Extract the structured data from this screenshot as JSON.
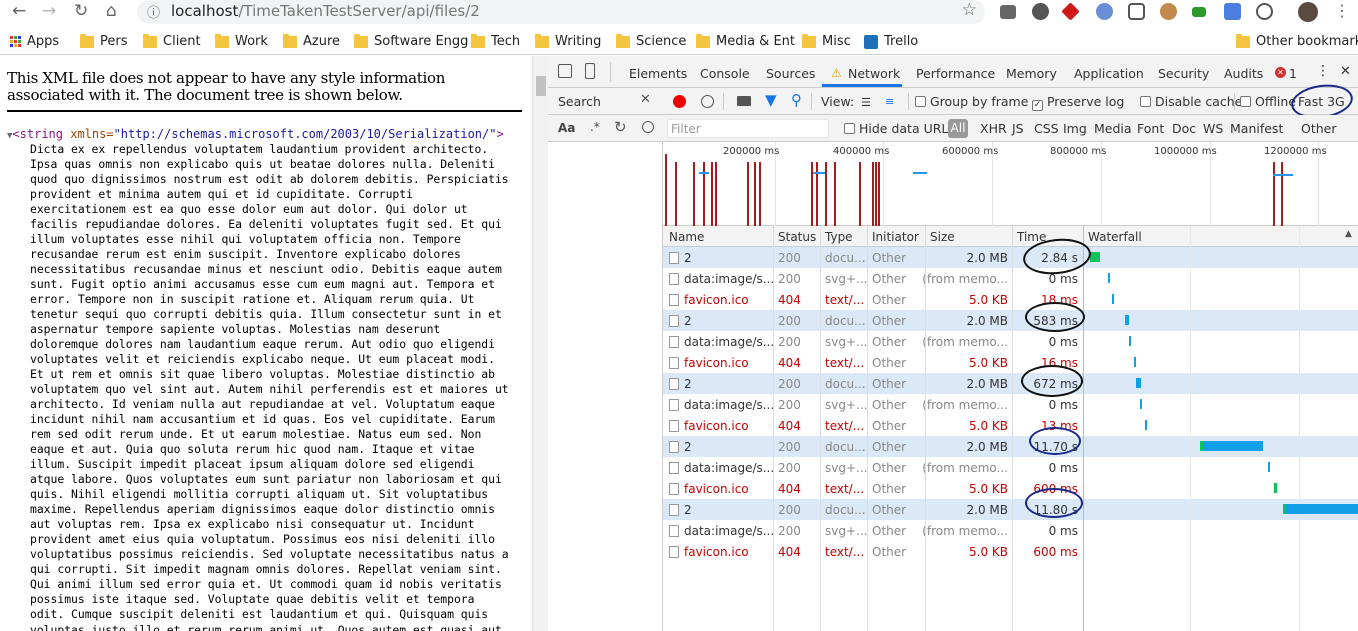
{
  "browser": {
    "url_host": "localhost",
    "url_path": "/TimeTakenTestServer/api/files/2",
    "bookmarks": [
      "Apps",
      "Pers",
      "Client",
      "Work",
      "Azure",
      "Software Engg",
      "Tech",
      "Writing",
      "Science",
      "Media & Ent",
      "Misc",
      "Trello"
    ],
    "other_bookmarks": "Other bookmarks"
  },
  "xml": {
    "header": "This XML file does not appear to have any style information associated with it. The document tree is shown below.",
    "tag_open": "<string",
    "attr_name": " xmlns=",
    "attr_value": "\"http://schemas.microsoft.com/2003/10/Serialization/\"",
    "tag_close": ">",
    "body_lines": [
      "Dicta ex ex repellendus voluptatem laudantium provident architecto.",
      "Ipsa quas omnis non explicabo quis ut beatae dolores nulla. Deleniti",
      "quod quo dignissimos nostrum est odit ab dolorem debitis. Perspiciatis",
      "provident et minima autem qui et id cupiditate. Corrupti",
      "exercitationem est ea quo esse dolor eum aut dolor. Qui dolor ut",
      "facilis repudiandae dolores. Ea deleniti voluptates fugit sed. Et qui",
      "illum voluptates esse nihil qui voluptatem officia non. Tempore",
      "recusandae rerum est enim suscipit. Inventore explicabo dolores",
      "necessitatibus recusandae minus et nesciunt odio. Debitis eaque autem",
      "sunt. Fugit optio animi accusamus esse cum eum magni aut. Tempora et",
      "error. Tempore non in suscipit ratione et. Aliquam rerum quia. Ut",
      "tenetur sequi quo corrupti debitis quia. Illum consectetur sunt in et",
      "aspernatur tempore sapiente voluptas. Molestias nam deserunt",
      "doloremque dolores nam laudantium eaque rerum. Aut odio quo eligendi",
      "voluptates velit et reiciendis explicabo neque. Ut eum placeat modi.",
      "Et ut rem et omnis sit quae libero voluptas. Molestiae distinctio ab",
      "voluptatem quo vel sint aut. Autem nihil perferendis est et maiores ut",
      "architecto. Id veniam nulla aut repudiandae at vel. Voluptatum eaque",
      "incidunt nihil nam accusantium et id quas. Eos vel cupiditate. Earum",
      "rem sed odit rerum unde. Et ut earum molestiae. Natus eum sed. Non",
      "eaque et aut. Quia quo soluta rerum hic quod nam. Itaque et vitae",
      "illum. Suscipit impedit placeat ipsum aliquam dolore sed eligendi",
      "atque labore. Quos voluptates eum sunt pariatur non laboriosam et qui",
      "quis. Nihil eligendi mollitia corrupti aliquam ut. Sit voluptatibus",
      "maxime. Repellendus aperiam dignissimos eaque dolor distinctio omnis",
      "aut voluptas rem. Ipsa ex explicabo nisi consequatur ut. Incidunt",
      "provident amet eius quia voluptatum. Possimus eos nisi deleniti illo",
      "voluptatibus possimus reiciendis. Sed voluptate necessitatibus natus a",
      "qui corrupti. Sit impedit magnam omnis dolores. Repellat veniam sint.",
      "Qui animi illum sed error quia et. Ut commodi quam id nobis veritatis",
      "possimus iste itaque sed. Voluptate quae debitis velit et tempora",
      "odit. Cumque suscipit deleniti est laudantium et qui. Quisquam quis",
      "voluptas iusto illo et rerum rerum animi ut. Quos autem est quasi aut"
    ]
  },
  "devtools": {
    "tabs": [
      "Elements",
      "Console",
      "Sources",
      "Network",
      "Performance",
      "Memory",
      "Application",
      "Security",
      "Audits"
    ],
    "error_count": "1",
    "search_label": "Search",
    "search_case": "Aa",
    "search_regex": ".*",
    "view_label": "View:",
    "group_by_frame": "Group by frame",
    "preserve_log": "Preserve log",
    "disable_cache": "Disable cache",
    "offline": "Offline",
    "throttle": "Fast 3G",
    "filter_placeholder": "Filter",
    "hide_data_urls": "Hide data URLs",
    "filter_types": [
      "All",
      "XHR",
      "JS",
      "CSS",
      "Img",
      "Media",
      "Font",
      "Doc",
      "WS",
      "Manifest",
      "Other"
    ],
    "overview_ticks": [
      "200000 ms",
      "400000 ms",
      "600000 ms",
      "800000 ms",
      "1000000 ms",
      "1200000 ms"
    ],
    "columns": [
      "Name",
      "Status",
      "Type",
      "Initiator",
      "Size",
      "Time",
      "Waterfall"
    ],
    "rows": [
      {
        "name": "2",
        "status": "200",
        "type": "docu...",
        "initiator": "Other",
        "size": "2.0 MB",
        "time": "2.84 s",
        "kind": "doc"
      },
      {
        "name": "data:image/s...",
        "status": "200",
        "type": "svg+...",
        "initiator": "Other",
        "size": "(from memo...",
        "time": "0 ms",
        "kind": "img"
      },
      {
        "name": "favicon.ico",
        "status": "404",
        "type": "text/...",
        "initiator": "Other",
        "size": "5.0 KB",
        "time": "18 ms",
        "kind": "err"
      },
      {
        "name": "2",
        "status": "200",
        "type": "docu...",
        "initiator": "Other",
        "size": "2.0 MB",
        "time": "583 ms",
        "kind": "doc"
      },
      {
        "name": "data:image/s...",
        "status": "200",
        "type": "svg+...",
        "initiator": "Other",
        "size": "(from memo...",
        "time": "0 ms",
        "kind": "img"
      },
      {
        "name": "favicon.ico",
        "status": "404",
        "type": "text/...",
        "initiator": "Other",
        "size": "5.0 KB",
        "time": "16 ms",
        "kind": "err"
      },
      {
        "name": "2",
        "status": "200",
        "type": "docu...",
        "initiator": "Other",
        "size": "2.0 MB",
        "time": "672 ms",
        "kind": "doc"
      },
      {
        "name": "data:image/s...",
        "status": "200",
        "type": "svg+...",
        "initiator": "Other",
        "size": "(from memo...",
        "time": "0 ms",
        "kind": "img"
      },
      {
        "name": "favicon.ico",
        "status": "404",
        "type": "text/...",
        "initiator": "Other",
        "size": "5.0 KB",
        "time": "13 ms",
        "kind": "err"
      },
      {
        "name": "2",
        "status": "200",
        "type": "docu...",
        "initiator": "Other",
        "size": "2.0 MB",
        "time": "11.70 s",
        "kind": "doc"
      },
      {
        "name": "data:image/s...",
        "status": "200",
        "type": "svg+...",
        "initiator": "Other",
        "size": "(from memo...",
        "time": "0 ms",
        "kind": "img"
      },
      {
        "name": "favicon.ico",
        "status": "404",
        "type": "text/...",
        "initiator": "Other",
        "size": "5.0 KB",
        "time": "600 ms",
        "kind": "err"
      },
      {
        "name": "2",
        "status": "200",
        "type": "docu...",
        "initiator": "Other",
        "size": "2.0 MB",
        "time": "11.80 s",
        "kind": "doc"
      },
      {
        "name": "data:image/s...",
        "status": "200",
        "type": "svg+...",
        "initiator": "Other",
        "size": "(from memo...",
        "time": "0 ms",
        "kind": "img"
      },
      {
        "name": "favicon.ico",
        "status": "404",
        "type": "text/...",
        "initiator": "Other",
        "size": "5.0 KB",
        "time": "600 ms",
        "kind": "err"
      }
    ]
  },
  "colors": {
    "error": "#c80000",
    "selected_row": "#dbe8f7",
    "waterfall_blue": "#10a0e8",
    "waterfall_green": "#0ac45a",
    "annotation": "#1a2a8a"
  }
}
